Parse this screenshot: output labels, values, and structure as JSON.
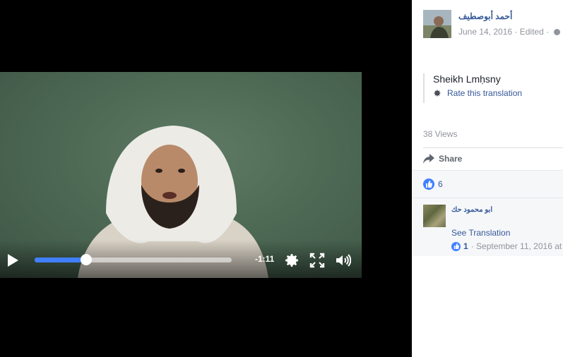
{
  "video": {
    "time_remaining": "-1:11",
    "progress": 0.26,
    "play_icon": "play-icon",
    "settings_icon": "gear-icon",
    "fullscreen_icon": "fullscreen-icon",
    "volume_icon": "volume-icon",
    "colors": {
      "progress": "#4080ff",
      "track": "#ffffffaa"
    }
  },
  "post": {
    "author": "أحمد أبوصطيف",
    "date": "June 14, 2016",
    "edited": "· Edited ·",
    "privacy_icon": "globe-icon",
    "translation_text": "Sheikh Lmḥsny",
    "rate_translation": "Rate this translation",
    "views": "38 Views",
    "share_label": "Share",
    "like_count": "6"
  },
  "comment": {
    "author": "ابو محمود حك",
    "see_translation": "See Translation",
    "likes": "1",
    "date": "· September 11, 2016 at"
  },
  "colors": {
    "link": "#365899",
    "muted": "#90949c",
    "accent": "#4080ff"
  }
}
